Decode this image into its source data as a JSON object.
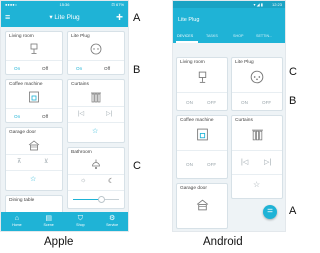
{
  "apple": {
    "status": {
      "carrier": "●●●●○",
      "time": "15:36",
      "battery": "⊡ 67%"
    },
    "title": "▾ Lite Plug",
    "plus": "+",
    "cards": {
      "living_room": {
        "title": "Living room",
        "on": "On",
        "off": "Off"
      },
      "lite_plug": {
        "title": "Lite Plug",
        "on": "On",
        "off": "Off"
      },
      "coffee_machine": {
        "title": "Coffee machine",
        "on": "On",
        "off": "Off"
      },
      "curtains": {
        "title": "Curtains",
        "prev": "|◁",
        "next": "▷|",
        "star": "☆"
      },
      "garage_door": {
        "title": "Garage door",
        "up": "⊼",
        "down": "⊻",
        "star": "☆"
      },
      "bathroom": {
        "title": "Bathroom",
        "sun": "☼",
        "moon": "☾",
        "brightness": 0.6
      },
      "dining_table": {
        "title": "Dining table"
      }
    },
    "tabs": [
      {
        "icon": "⌂",
        "label": "Home"
      },
      {
        "icon": "▤",
        "label": "Scene"
      },
      {
        "icon": "⛉",
        "label": "Shop"
      },
      {
        "icon": "⚙",
        "label": "Service"
      }
    ]
  },
  "android": {
    "status": {
      "signal": "▾ ◢ ▮",
      "time": "12:23"
    },
    "title": "Lite Plug",
    "tabs": [
      "DEVICES",
      "TASKS",
      "SHOP",
      "SETTIN..."
    ],
    "cards": {
      "living_room": {
        "title": "Living room",
        "on": "ON",
        "off": "OFF"
      },
      "lite_plug": {
        "title": "Lite Plug",
        "on": "ON",
        "off": "OFF"
      },
      "coffee_machine": {
        "title": "Coffee machine",
        "on": "ON",
        "off": "OFF"
      },
      "curtains": {
        "title": "Curtains",
        "prev": "|◁",
        "next": "▷|",
        "star": "☆"
      },
      "garage_door": {
        "title": "Garage door"
      }
    },
    "fab": "="
  },
  "annotations": {
    "a_left": "A",
    "b_left": "B",
    "c_left": "C",
    "c_right": "C",
    "b_right": "B",
    "a_right": "A"
  },
  "captions": {
    "apple": "Apple",
    "android": "Android"
  },
  "colors": {
    "accent": "#1fb3d6",
    "background": "#eef3f6"
  }
}
